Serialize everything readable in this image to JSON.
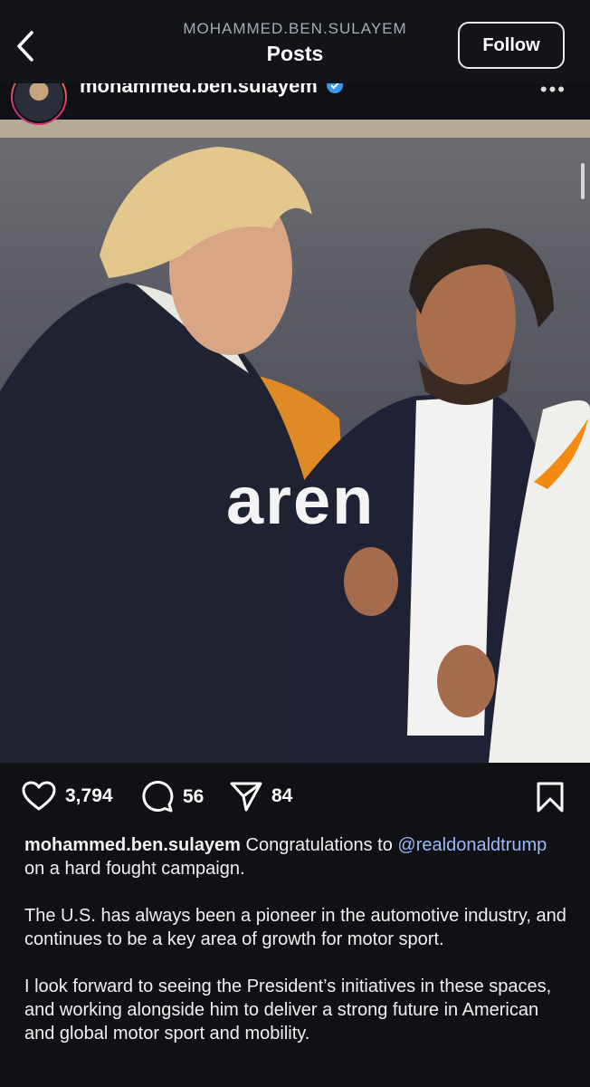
{
  "header": {
    "username_caps": "MOHAMMED.BEN.SULAYEM",
    "title": "Posts",
    "follow_label": "Follow"
  },
  "post": {
    "author": "mohammed.ben.sulayem",
    "photo_sign_text": "aren",
    "likes": "3,794",
    "comments": "56",
    "shares": "84",
    "caption": {
      "lead": "Congratulations to",
      "mention": "@realdonaldtrump",
      "lead_rest": "on a hard fought campaign.",
      "paragraph2": "The U.S. has always been a pioneer in the automotive industry, and continues to be a key area of growth for motor sport.",
      "paragraph3": "I look forward to seeing the President’s initiatives in these spaces, and working alongside him to deliver a strong future in American and global motor sport and mobility."
    }
  },
  "icons": {
    "back": "chevron-left-icon",
    "verified": "verified-badge-icon",
    "like": "heart-icon",
    "comment": "comment-icon",
    "share": "send-icon",
    "save": "bookmark-icon"
  },
  "colors": {
    "background": "#0f1115",
    "mention": "#9db8f5",
    "verified": "#3897f0"
  }
}
